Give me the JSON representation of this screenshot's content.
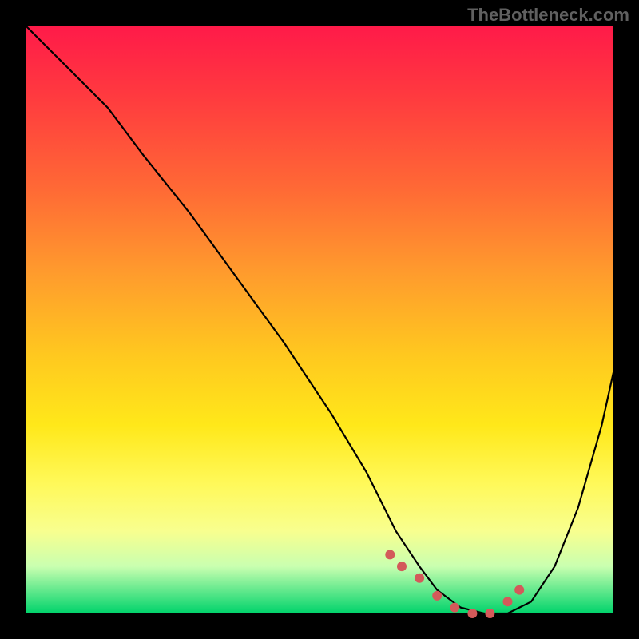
{
  "attribution": "TheBottleneck.com",
  "colors": {
    "gradient_top": "#ff1a49",
    "gradient_mid": "#ffe81a",
    "gradient_bottom": "#00d36b",
    "curve": "#000000",
    "dot": "#d35a5a",
    "frame": "#000000"
  },
  "chart_data": {
    "type": "line",
    "title": "",
    "xlabel": "",
    "ylabel": "",
    "xlim": [
      0,
      100
    ],
    "ylim": [
      0,
      100
    ],
    "grid": false,
    "series": [
      {
        "name": "bottleneck-curve",
        "x": [
          0,
          4,
          8,
          14,
          20,
          28,
          36,
          44,
          52,
          58,
          63,
          67,
          70,
          74,
          78,
          82,
          86,
          90,
          94,
          98,
          100
        ],
        "y": [
          100,
          96,
          92,
          86,
          78,
          68,
          57,
          46,
          34,
          24,
          14,
          8,
          4,
          1,
          0,
          0,
          2,
          8,
          18,
          32,
          41
        ]
      }
    ],
    "markers": {
      "name": "highlight-dots",
      "x": [
        62,
        64,
        67,
        70,
        73,
        76,
        79,
        82,
        84
      ],
      "y": [
        10,
        8,
        6,
        3,
        1,
        0,
        0,
        2,
        4
      ]
    }
  }
}
